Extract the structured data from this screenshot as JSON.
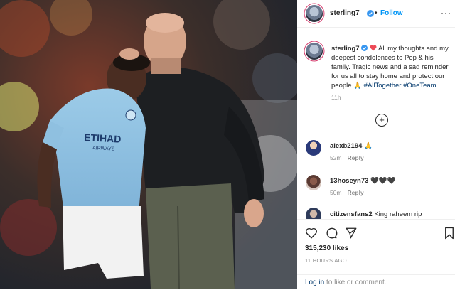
{
  "post": {
    "username": "sterling7",
    "follow_label": "Follow",
    "more_label": "···"
  },
  "caption": {
    "username": "sterling7",
    "text": "All my thoughts and my deepest condolences to Pep & his family. Tragic news and a sad reminder for us all to stay home and protect our people",
    "hashtags": "#AllTogether #OneTeam",
    "time": "11h"
  },
  "load_more_label": "+",
  "comments": [
    {
      "username": "alexb2194",
      "text": "🙏",
      "time": "52m",
      "reply": "Reply"
    },
    {
      "username": "13hoseyn73",
      "text": "🖤🖤🖤",
      "time": "50m",
      "reply": "Reply"
    },
    {
      "username": "citizensfans2",
      "text": "King raheem rip",
      "time": "",
      "reply": ""
    }
  ],
  "actions": {
    "likes": "315,230 likes",
    "ago": "11 HOURS AGO",
    "login_link": "Log in",
    "login_rest": " to like or comment."
  },
  "colors": {
    "accent": "#0095f6",
    "verified": "#3897f0",
    "heart": "#ed4956",
    "text": "#262626",
    "muted": "#8e8e8e"
  }
}
